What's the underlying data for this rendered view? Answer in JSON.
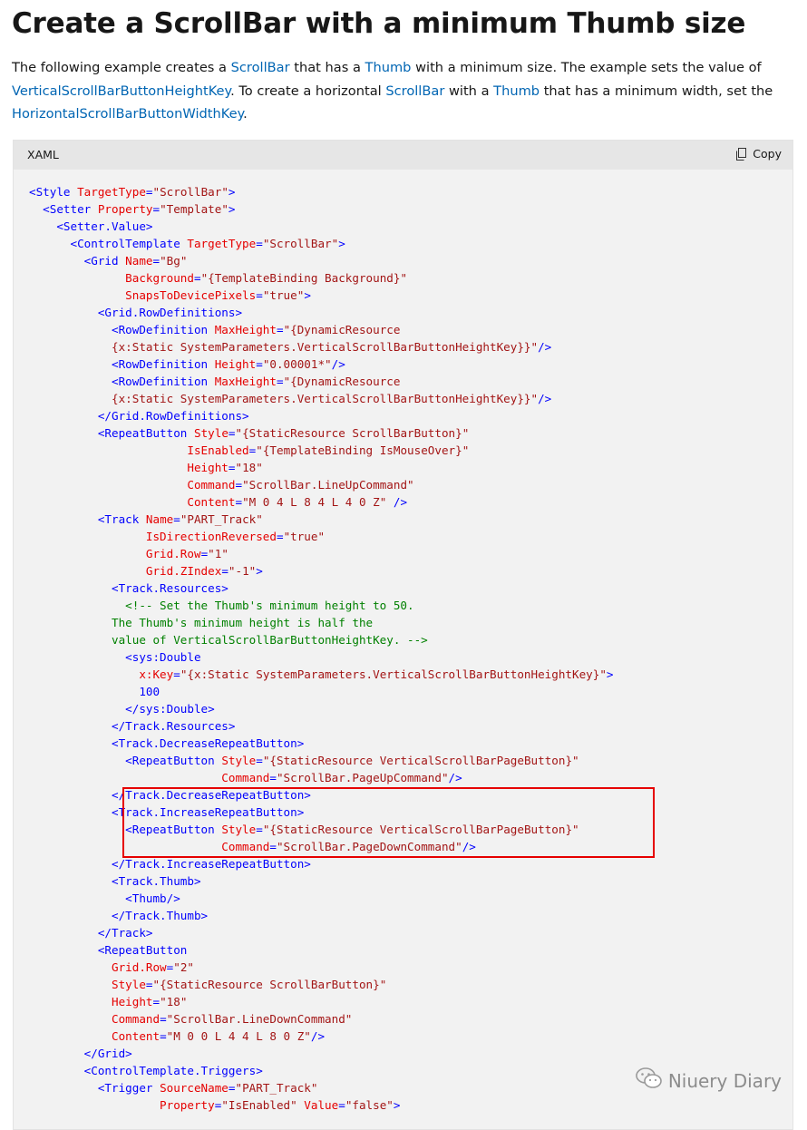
{
  "heading": "Create a ScrollBar with a minimum Thumb size",
  "description": {
    "t1": "The following example creates a ",
    "link_scrollbar_1": "ScrollBar",
    "t2": " that has a ",
    "link_thumb_1": "Thumb",
    "t3": " with a minimum size. The example sets the value of ",
    "link_vkey": "VerticalScrollBarButtonHeightKey",
    "t4": ". To create a horizontal ",
    "link_scrollbar_2": "ScrollBar",
    "t5": " with a ",
    "link_thumb_2": "Thumb",
    "t6": " that has a minimum width, set the ",
    "link_hkey": "HorizontalScrollBarButtonWidthKey",
    "t7": "."
  },
  "code": {
    "language": "XAML",
    "copy_label": "Copy",
    "lines": [
      [
        [
          "t",
          "<Style "
        ],
        [
          "a",
          "TargetType"
        ],
        [
          "p",
          "="
        ],
        [
          "v",
          "\"ScrollBar\""
        ],
        [
          "t",
          ">"
        ]
      ],
      [
        [
          "t",
          "  <Setter "
        ],
        [
          "a",
          "Property"
        ],
        [
          "p",
          "="
        ],
        [
          "v",
          "\"Template\""
        ],
        [
          "t",
          ">"
        ]
      ],
      [
        [
          "t",
          "    <Setter.Value>"
        ]
      ],
      [
        [
          "t",
          "      <ControlTemplate "
        ],
        [
          "a",
          "TargetType"
        ],
        [
          "p",
          "="
        ],
        [
          "v",
          "\"ScrollBar\""
        ],
        [
          "t",
          ">"
        ]
      ],
      [
        [
          "t",
          "        <Grid "
        ],
        [
          "a",
          "Name"
        ],
        [
          "p",
          "="
        ],
        [
          "v",
          "\"Bg\""
        ]
      ],
      [
        [
          "a",
          "              Background"
        ],
        [
          "p",
          "="
        ],
        [
          "v",
          "\"{TemplateBinding Background}\""
        ]
      ],
      [
        [
          "a",
          "              SnapsToDevicePixels"
        ],
        [
          "p",
          "="
        ],
        [
          "v",
          "\"true\""
        ],
        [
          "t",
          ">"
        ]
      ],
      [
        [
          "t",
          "          <Grid.RowDefinitions>"
        ]
      ],
      [
        [
          "t",
          "            <RowDefinition "
        ],
        [
          "a",
          "MaxHeight"
        ],
        [
          "p",
          "="
        ],
        [
          "v",
          "\"{DynamicResource"
        ]
      ],
      [
        [
          "v",
          "            {x:Static SystemParameters.VerticalScrollBarButtonHeightKey}}\""
        ],
        [
          "t",
          "/>"
        ]
      ],
      [
        [
          "t",
          "            <RowDefinition "
        ],
        [
          "a",
          "Height"
        ],
        [
          "p",
          "="
        ],
        [
          "v",
          "\"0.00001*\""
        ],
        [
          "t",
          "/>"
        ]
      ],
      [
        [
          "t",
          "            <RowDefinition "
        ],
        [
          "a",
          "MaxHeight"
        ],
        [
          "p",
          "="
        ],
        [
          "v",
          "\"{DynamicResource"
        ]
      ],
      [
        [
          "v",
          "            {x:Static SystemParameters.VerticalScrollBarButtonHeightKey}}\""
        ],
        [
          "t",
          "/>"
        ]
      ],
      [
        [
          "t",
          "          </Grid.RowDefinitions>"
        ]
      ],
      [
        [
          "t",
          "          <RepeatButton "
        ],
        [
          "a",
          "Style"
        ],
        [
          "p",
          "="
        ],
        [
          "v",
          "\"{StaticResource ScrollBarButton}\""
        ]
      ],
      [
        [
          "a",
          "                       IsEnabled"
        ],
        [
          "p",
          "="
        ],
        [
          "v",
          "\"{TemplateBinding IsMouseOver}\""
        ]
      ],
      [
        [
          "a",
          "                       Height"
        ],
        [
          "p",
          "="
        ],
        [
          "v",
          "\"18\""
        ]
      ],
      [
        [
          "a",
          "                       Command"
        ],
        [
          "p",
          "="
        ],
        [
          "v",
          "\"ScrollBar.LineUpCommand\""
        ]
      ],
      [
        [
          "a",
          "                       Content"
        ],
        [
          "p",
          "="
        ],
        [
          "v",
          "\"M 0 4 L 8 4 L 4 0 Z\""
        ],
        [
          "t",
          " />"
        ]
      ],
      [
        [
          "t",
          "          <Track "
        ],
        [
          "a",
          "Name"
        ],
        [
          "p",
          "="
        ],
        [
          "v",
          "\"PART_Track\""
        ]
      ],
      [
        [
          "a",
          "                 IsDirectionReversed"
        ],
        [
          "p",
          "="
        ],
        [
          "v",
          "\"true\""
        ]
      ],
      [
        [
          "a",
          "                 Grid.Row"
        ],
        [
          "p",
          "="
        ],
        [
          "v",
          "\"1\""
        ]
      ],
      [
        [
          "a",
          "                 Grid.ZIndex"
        ],
        [
          "p",
          "="
        ],
        [
          "v",
          "\"-1\""
        ],
        [
          "t",
          ">"
        ]
      ],
      [
        [
          "t",
          "            <Track.Resources>"
        ]
      ],
      [
        [
          "c",
          "              <!-- Set the Thumb's minimum height to 50."
        ]
      ],
      [
        [
          "c",
          "            The Thumb's minimum height is half the"
        ]
      ],
      [
        [
          "c",
          "            value of VerticalScrollBarButtonHeightKey. -->"
        ]
      ],
      [
        [
          "t",
          "              <sys:Double"
        ]
      ],
      [
        [
          "a",
          "                x:Key"
        ],
        [
          "p",
          "="
        ],
        [
          "v",
          "\"{x:Static SystemParameters.VerticalScrollBarButtonHeightKey}\""
        ],
        [
          "t",
          ">"
        ]
      ],
      [
        [
          "p",
          "                100"
        ]
      ],
      [
        [
          "t",
          "              </sys:Double>"
        ]
      ],
      [
        [
          "t",
          "            </Track.Resources>"
        ]
      ],
      [
        [
          "t",
          "            <Track.DecreaseRepeatButton>"
        ]
      ],
      [
        [
          "t",
          "              <RepeatButton "
        ],
        [
          "a",
          "Style"
        ],
        [
          "p",
          "="
        ],
        [
          "v",
          "\"{StaticResource VerticalScrollBarPageButton}\""
        ]
      ],
      [
        [
          "a",
          "                            Command"
        ],
        [
          "p",
          "="
        ],
        [
          "v",
          "\"ScrollBar.PageUpCommand\""
        ],
        [
          "t",
          "/>"
        ]
      ],
      [
        [
          "t",
          "            </Track.DecreaseRepeatButton>"
        ]
      ],
      [
        [
          "t",
          "            <Track.IncreaseRepeatButton>"
        ]
      ],
      [
        [
          "t",
          "              <RepeatButton "
        ],
        [
          "a",
          "Style"
        ],
        [
          "p",
          "="
        ],
        [
          "v",
          "\"{StaticResource VerticalScrollBarPageButton}\""
        ]
      ],
      [
        [
          "a",
          "                            Command"
        ],
        [
          "p",
          "="
        ],
        [
          "v",
          "\"ScrollBar.PageDownCommand\""
        ],
        [
          "t",
          "/>"
        ]
      ],
      [
        [
          "t",
          "            </Track.IncreaseRepeatButton>"
        ]
      ],
      [
        [
          "t",
          "            <Track.Thumb>"
        ]
      ],
      [
        [
          "t",
          "              <Thumb/>"
        ]
      ],
      [
        [
          "t",
          "            </Track.Thumb>"
        ]
      ],
      [
        [
          "t",
          "          </Track>"
        ]
      ],
      [
        [
          "t",
          "          <RepeatButton"
        ]
      ],
      [
        [
          "a",
          "            Grid.Row"
        ],
        [
          "p",
          "="
        ],
        [
          "v",
          "\"2\""
        ]
      ],
      [
        [
          "a",
          "            Style"
        ],
        [
          "p",
          "="
        ],
        [
          "v",
          "\"{StaticResource ScrollBarButton}\""
        ]
      ],
      [
        [
          "a",
          "            Height"
        ],
        [
          "p",
          "="
        ],
        [
          "v",
          "\"18\""
        ]
      ],
      [
        [
          "a",
          "            Command"
        ],
        [
          "p",
          "="
        ],
        [
          "v",
          "\"ScrollBar.LineDownCommand\""
        ]
      ],
      [
        [
          "a",
          "            Content"
        ],
        [
          "p",
          "="
        ],
        [
          "v",
          "\"M 0 0 L 4 4 L 8 0 Z\""
        ],
        [
          "t",
          "/>"
        ]
      ],
      [
        [
          "t",
          "        </Grid>"
        ]
      ],
      [
        [
          "t",
          "        <ControlTemplate.Triggers>"
        ]
      ],
      [
        [
          "t",
          "          <Trigger "
        ],
        [
          "a",
          "SourceName"
        ],
        [
          "p",
          "="
        ],
        [
          "v",
          "\"PART_Track\""
        ]
      ],
      [
        [
          "a",
          "                   Property"
        ],
        [
          "p",
          "="
        ],
        [
          "v",
          "\"IsEnabled\""
        ],
        [
          "a",
          " Value"
        ],
        [
          "p",
          "="
        ],
        [
          "v",
          "\"false\""
        ],
        [
          "t",
          ">"
        ]
      ]
    ]
  },
  "watermark": "Niuery Diary",
  "colors": {
    "link": "#0065b3",
    "tag": "#0101fd",
    "attribute": "#e50000",
    "value": "#a31515",
    "comment": "#008000",
    "highlight_border": "#e60000"
  }
}
